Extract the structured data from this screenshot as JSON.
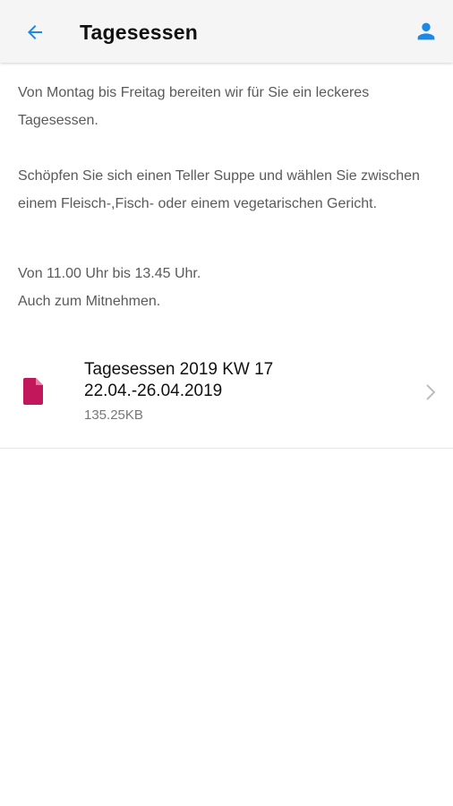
{
  "header": {
    "title": "Tagesessen",
    "back_icon": "arrow-left-icon",
    "account_icon": "person-icon",
    "accent_color": "#1e88e5"
  },
  "content": {
    "paragraphs": [
      "Von Montag bis Freitag bereiten wir für Sie ein leckeres Tagesessen.",
      "Schöpfen Sie sich einen Teller Suppe und wählen Sie zwischen einem Fleisch-,Fisch- oder einem vegetarischen Gericht.",
      "Von 11.00 Uhr bis 13.45 Uhr.",
      "Auch zum Mitnehmen."
    ]
  },
  "attachment": {
    "title_line1": "Tagesessen 2019 KW 17",
    "title_line2": "22.04.-26.04.2019",
    "size": "135.25KB",
    "icon": "file-icon",
    "icon_color": "#c2185b",
    "chevron_icon": "chevron-right-icon"
  }
}
